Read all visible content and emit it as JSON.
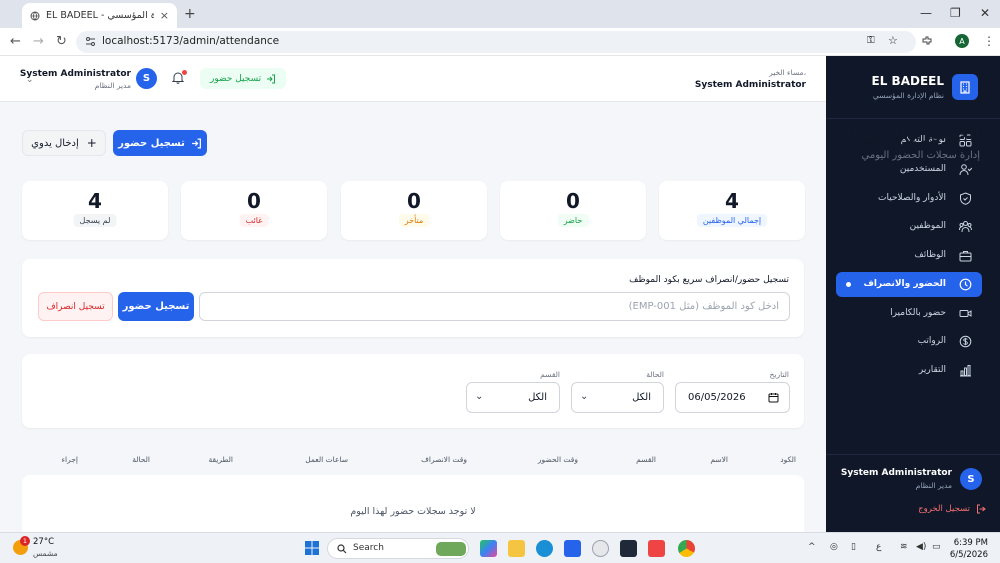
{
  "browser": {
    "tab_title": "EL BADEEL - نظام الإدارة المؤسسي",
    "url": "localhost:5173/admin/attendance",
    "profile_initial": "A"
  },
  "sidebar": {
    "brand_name": "EL BADEEL",
    "brand_sub": "نظام الإدارة المؤسسي",
    "items": [
      {
        "label": "لوحة التحكم",
        "icon": "grid-icon"
      },
      {
        "label": "المستخدمين",
        "icon": "users-icon"
      },
      {
        "label": "الأدوار والصلاحيات",
        "icon": "shield-icon"
      },
      {
        "label": "الموظفين",
        "icon": "team-icon"
      },
      {
        "label": "الوظائف",
        "icon": "briefcase-icon"
      },
      {
        "label": "الحضور والانصراف",
        "icon": "clock-icon",
        "active": true
      },
      {
        "label": "حضور بالكاميرا",
        "icon": "camera-icon"
      },
      {
        "label": "الرواتب",
        "icon": "dollar-icon"
      },
      {
        "label": "التقارير",
        "icon": "chart-icon"
      }
    ],
    "user_initial": "S",
    "user_name": "System Administrator",
    "user_role": "مدير النظام",
    "logout": "تسجيل الخروج"
  },
  "header": {
    "greeting": "مساء الخير،",
    "greeting_name": "System Administrator",
    "checkin_label": "تسجيل حضور",
    "user_initial": "S",
    "user_name": "System Administrator",
    "user_role": "مدير النظام"
  },
  "page": {
    "title": "الحضور والانصراف",
    "subtitle": "إدارة سجلات الحضور اليومي",
    "checkin_button": "تسجيل حضور",
    "manual_button": "إدخال يدوي"
  },
  "stats": [
    {
      "value": "4",
      "label": "إجمالي الموظفين",
      "color": "#2563eb",
      "bg": "#eff6ff"
    },
    {
      "value": "0",
      "label": "حاضر",
      "color": "#16a34a",
      "bg": "#f0fdf4"
    },
    {
      "value": "0",
      "label": "متأخر",
      "color": "#d97706",
      "bg": "#fffbeb"
    },
    {
      "value": "0",
      "label": "غائب",
      "color": "#dc2626",
      "bg": "#fef2f2"
    },
    {
      "value": "4",
      "label": "لم يسجل",
      "color": "#374151",
      "bg": "#f3f4f6"
    }
  ],
  "quick": {
    "label": "تسجيل حضور/انصراف سريع بكود الموظف",
    "placeholder": "أدخل كود الموظف (مثل EMP-001)",
    "checkin": "تسجيل حضور",
    "checkout": "تسجيل انصراف"
  },
  "filters": {
    "date_label": "التاريخ",
    "date_value": "06/05/2026",
    "status_label": "الحالة",
    "status_value": "الكل",
    "dept_label": "القسم",
    "dept_value": "الكل"
  },
  "table": {
    "columns": [
      "الكود",
      "الاسم",
      "القسم",
      "وقت الحضور",
      "وقت الانصراف",
      "ساعات العمل",
      "الطريقة",
      "الحالة",
      "إجراء"
    ],
    "empty_message": "لا توجد سجلات حضور لهذا اليوم"
  },
  "taskbar": {
    "temperature": "27°C",
    "weather": "مشمس",
    "search": "Search",
    "time": "6:39 PM",
    "date": "6/5/2026",
    "lang": "ع",
    "notification_count": "1"
  }
}
